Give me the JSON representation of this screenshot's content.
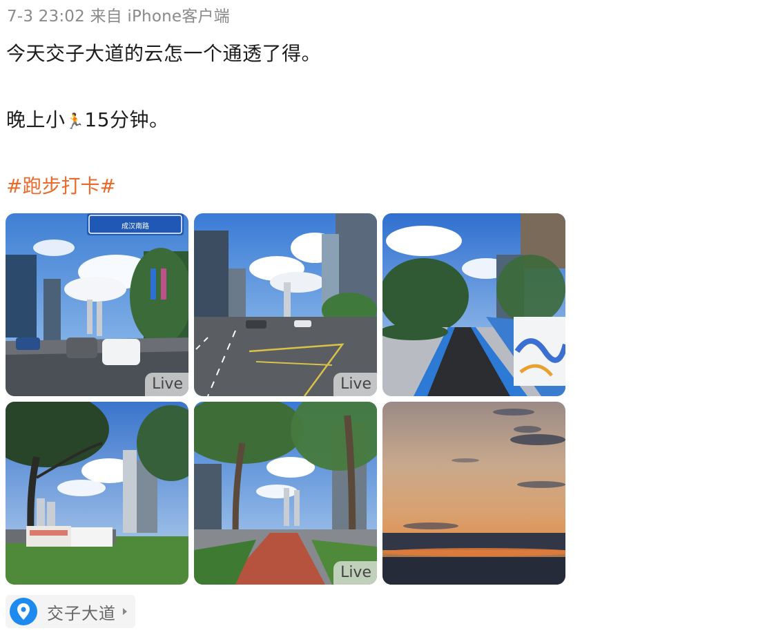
{
  "post": {
    "meta": "7-3 23:02  来自 iPhone客户端",
    "line1": "今天交子大道的云怎一个通透了得。",
    "line2_prefix": "晚上小",
    "line2_emoji": "🏃",
    "line2_suffix": "15分钟。",
    "hashtag": "#跑步打卡#"
  },
  "photos": [
    {
      "label": "Live",
      "sign_text": "成汉南路"
    },
    {
      "label": "Live"
    },
    {
      "label": ""
    },
    {
      "label": ""
    },
    {
      "label": "Live"
    },
    {
      "label": ""
    }
  ],
  "location": {
    "name": "交子大道",
    "icon": "location-pin-icon",
    "accent": "#1d8af0"
  },
  "colors": {
    "hashtag": "#eb6a2b",
    "meta": "#8a8a8a"
  }
}
